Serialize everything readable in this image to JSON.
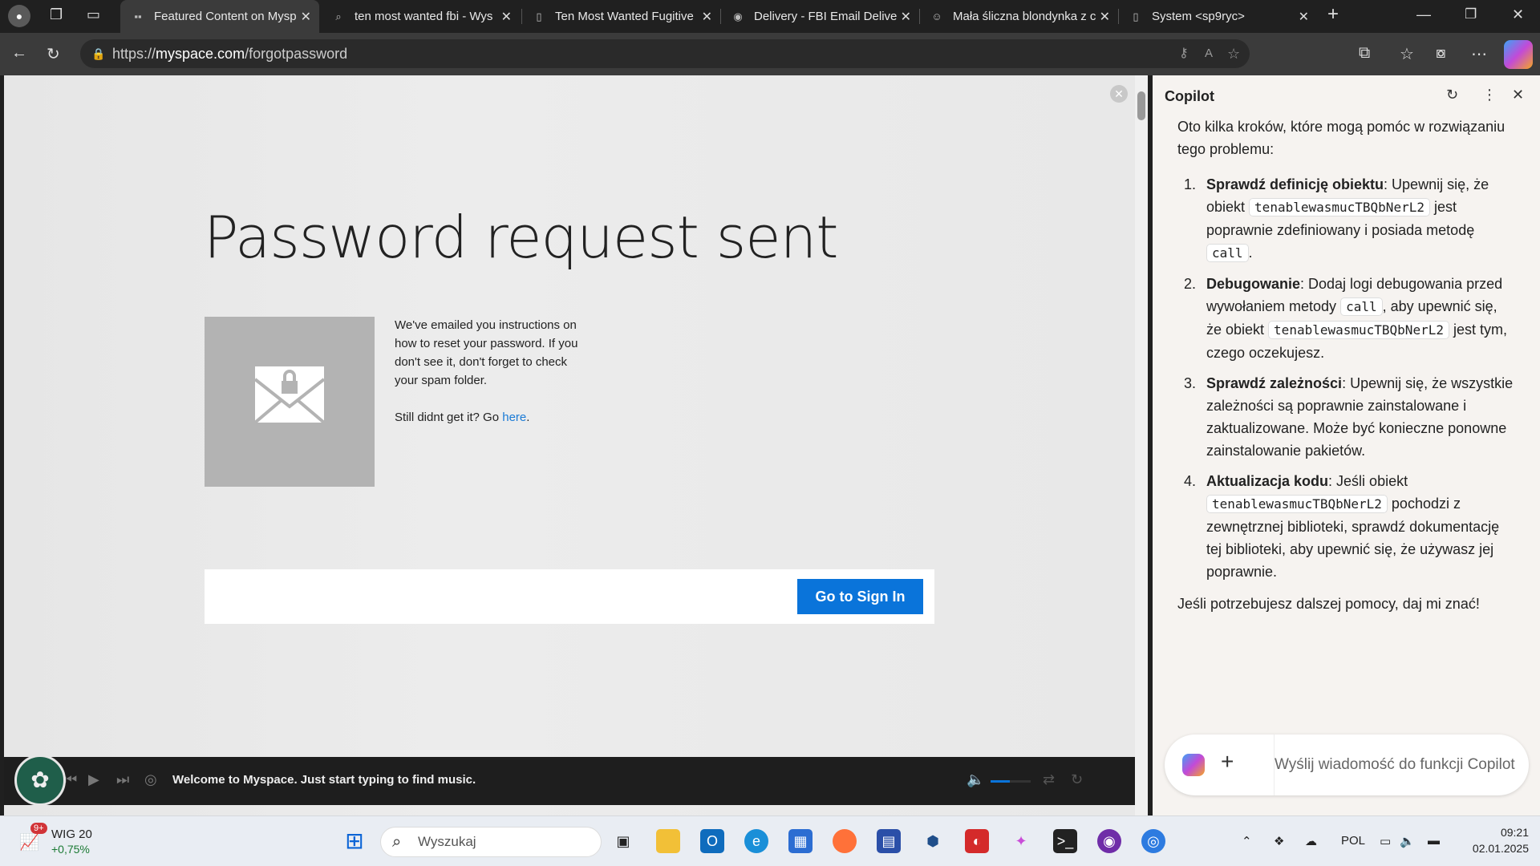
{
  "browser": {
    "tabs": [
      {
        "title": "Featured Content on Mysp",
        "icon": "myspace-icon",
        "active": true
      },
      {
        "title": "ten most wanted fbi - Wys",
        "icon": "search-icon",
        "active": false
      },
      {
        "title": "Ten Most Wanted Fugitive",
        "icon": "page-icon",
        "active": false
      },
      {
        "title": "Delivery - FBI Email Delive",
        "icon": "fbi-seal-icon",
        "active": false
      },
      {
        "title": "Mała śliczna blondynka z c",
        "icon": "cat-icon",
        "active": false
      },
      {
        "title": "System <sp9ryc>",
        "icon": "page-icon",
        "active": false
      }
    ],
    "url_prefix": "https://",
    "url_domain": "myspace.com",
    "url_path": "/forgotpassword"
  },
  "page": {
    "title": "Password request sent",
    "message": "We've emailed you instructions on how to reset your password. If you don't see it, don't forget to check your spam folder.",
    "still_text": "Still didnt get it? Go ",
    "here_link": "here",
    "period": ".",
    "go_sign_in": "Go to Sign In",
    "player_text": "Welcome to Myspace. Just start typing to find music."
  },
  "copilot": {
    "title": "Copilot",
    "intro": "Oto kilka kroków, które mogą pomóc w rozwiązaniu tego problemu:",
    "steps": [
      {
        "bold": "Sprawdź definicję obiektu",
        "t1": ": Upewnij się, że obiekt ",
        "c1": "tenablewasmucTBQbNerL2",
        "t2": " jest poprawnie zdefiniowany i posiada metodę ",
        "c2": "call",
        "t3": "."
      },
      {
        "bold": "Debugowanie",
        "t1": ": Dodaj logi debugowania przed wywołaniem metody ",
        "c1": "call",
        "t2": ", aby upewnić się, że obiekt ",
        "c2": "tenablewasmucTBQbNerL2",
        "t3": " jest tym, czego oczekujesz."
      },
      {
        "bold": "Sprawdź zależności",
        "t1": ": Upewnij się, że wszystkie zależności są poprawnie zainstalowane i zaktualizowane. Może być konieczne ponowne zainstalowanie pakietów."
      },
      {
        "bold": "Aktualizacja kodu",
        "t1": ": Jeśli obiekt ",
        "c1": "tenablewasmucTBQbNerL2",
        "t2": " pochodzi z zewnętrznej biblioteki, sprawdź dokumentację tej biblioteki, aby upewnić się, że używasz jej poprawnie."
      }
    ],
    "outro": "Jeśli potrzebujesz dalszej pomocy, daj mi znać!",
    "input_placeholder": "Wyślij wiadomość do funkcji Copilot"
  },
  "taskbar": {
    "stock_badge": "9+",
    "stock_name": "WIG 20",
    "stock_change": "+0,75%",
    "search_placeholder": "Wyszukaj",
    "lang": "POL",
    "time": "09:21",
    "date": "02.01.2025"
  }
}
